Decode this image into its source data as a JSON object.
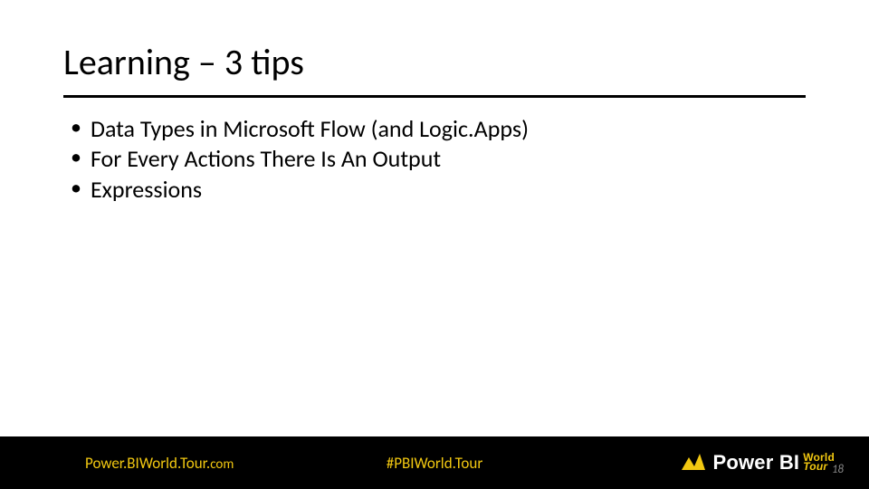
{
  "title": "Learning – 3 tips",
  "bullets": [
    "Data Types in Microsoft Flow (and Logic.Apps)",
    "For Every Actions There Is An Output",
    "Expressions"
  ],
  "footer": {
    "site_main": "Power.BIWorld.Tour.",
    "site_domain": "com",
    "hashtag": "#PBIWorld.Tour"
  },
  "logo": {
    "brand": "Power BI",
    "sub1": "World",
    "sub2": "Tour"
  },
  "slide_number": "18"
}
